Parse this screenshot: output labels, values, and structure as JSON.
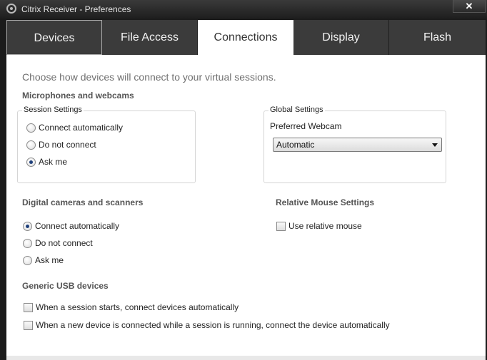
{
  "window": {
    "title": "Citrix Receiver - Preferences",
    "close_glyph": "✕"
  },
  "tabs": [
    {
      "label": "Devices",
      "active": false
    },
    {
      "label": "File Access",
      "active": false
    },
    {
      "label": "Connections",
      "active": true
    },
    {
      "label": "Display",
      "active": false
    },
    {
      "label": "Flash",
      "active": false
    }
  ],
  "intro": "Choose how devices will connect to your virtual sessions.",
  "microphones": {
    "heading": "Microphones and webcams",
    "session_group": "Session Settings",
    "options": [
      {
        "label": "Connect automatically",
        "selected": false
      },
      {
        "label": "Do not connect",
        "selected": false
      },
      {
        "label": "Ask me",
        "selected": true
      }
    ],
    "global_group": "Global Settings",
    "webcam_label": "Preferred Webcam",
    "webcam_value": "Automatic"
  },
  "cameras": {
    "heading": "Digital cameras and scanners",
    "options": [
      {
        "label": "Connect automatically",
        "selected": true
      },
      {
        "label": "Do not connect",
        "selected": false
      },
      {
        "label": "Ask me",
        "selected": false
      }
    ]
  },
  "mouse": {
    "heading": "Relative Mouse Settings",
    "checkbox_label": "Use relative mouse",
    "checked": false
  },
  "usb": {
    "heading": "Generic USB devices",
    "options": [
      {
        "label": "When a session starts, connect devices automatically",
        "checked": false
      },
      {
        "label": "When a new device is connected while a session is running, connect the device automatically",
        "checked": false
      }
    ]
  },
  "icons": {
    "app": "citrix-icon",
    "close": "close-icon",
    "dropdown": "chevron-down-icon"
  }
}
